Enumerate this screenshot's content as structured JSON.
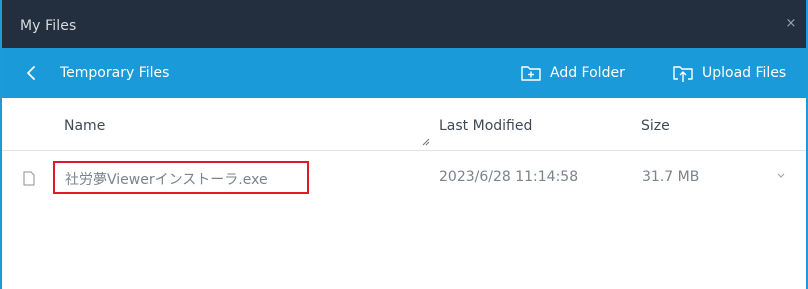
{
  "window": {
    "title": "My Files",
    "close_glyph": "×"
  },
  "navbar": {
    "back_icon": "chevron-left-icon",
    "breadcrumb": "Temporary Files",
    "add_folder_label": "Add Folder",
    "upload_files_label": "Upload Files"
  },
  "table": {
    "columns": {
      "name": "Name",
      "last_modified": "Last Modified",
      "size": "Size"
    },
    "rows": [
      {
        "name": "社労夢Viewerインストーラ.exe",
        "last_modified": "2023/6/28 11:14:58",
        "size": "31.7 MB",
        "highlighted": true
      }
    ]
  },
  "colors": {
    "titlebar": "#232f3e",
    "navbar": "#1a9ad8",
    "highlight": "#e0192b",
    "border": "#1d9bd6"
  }
}
